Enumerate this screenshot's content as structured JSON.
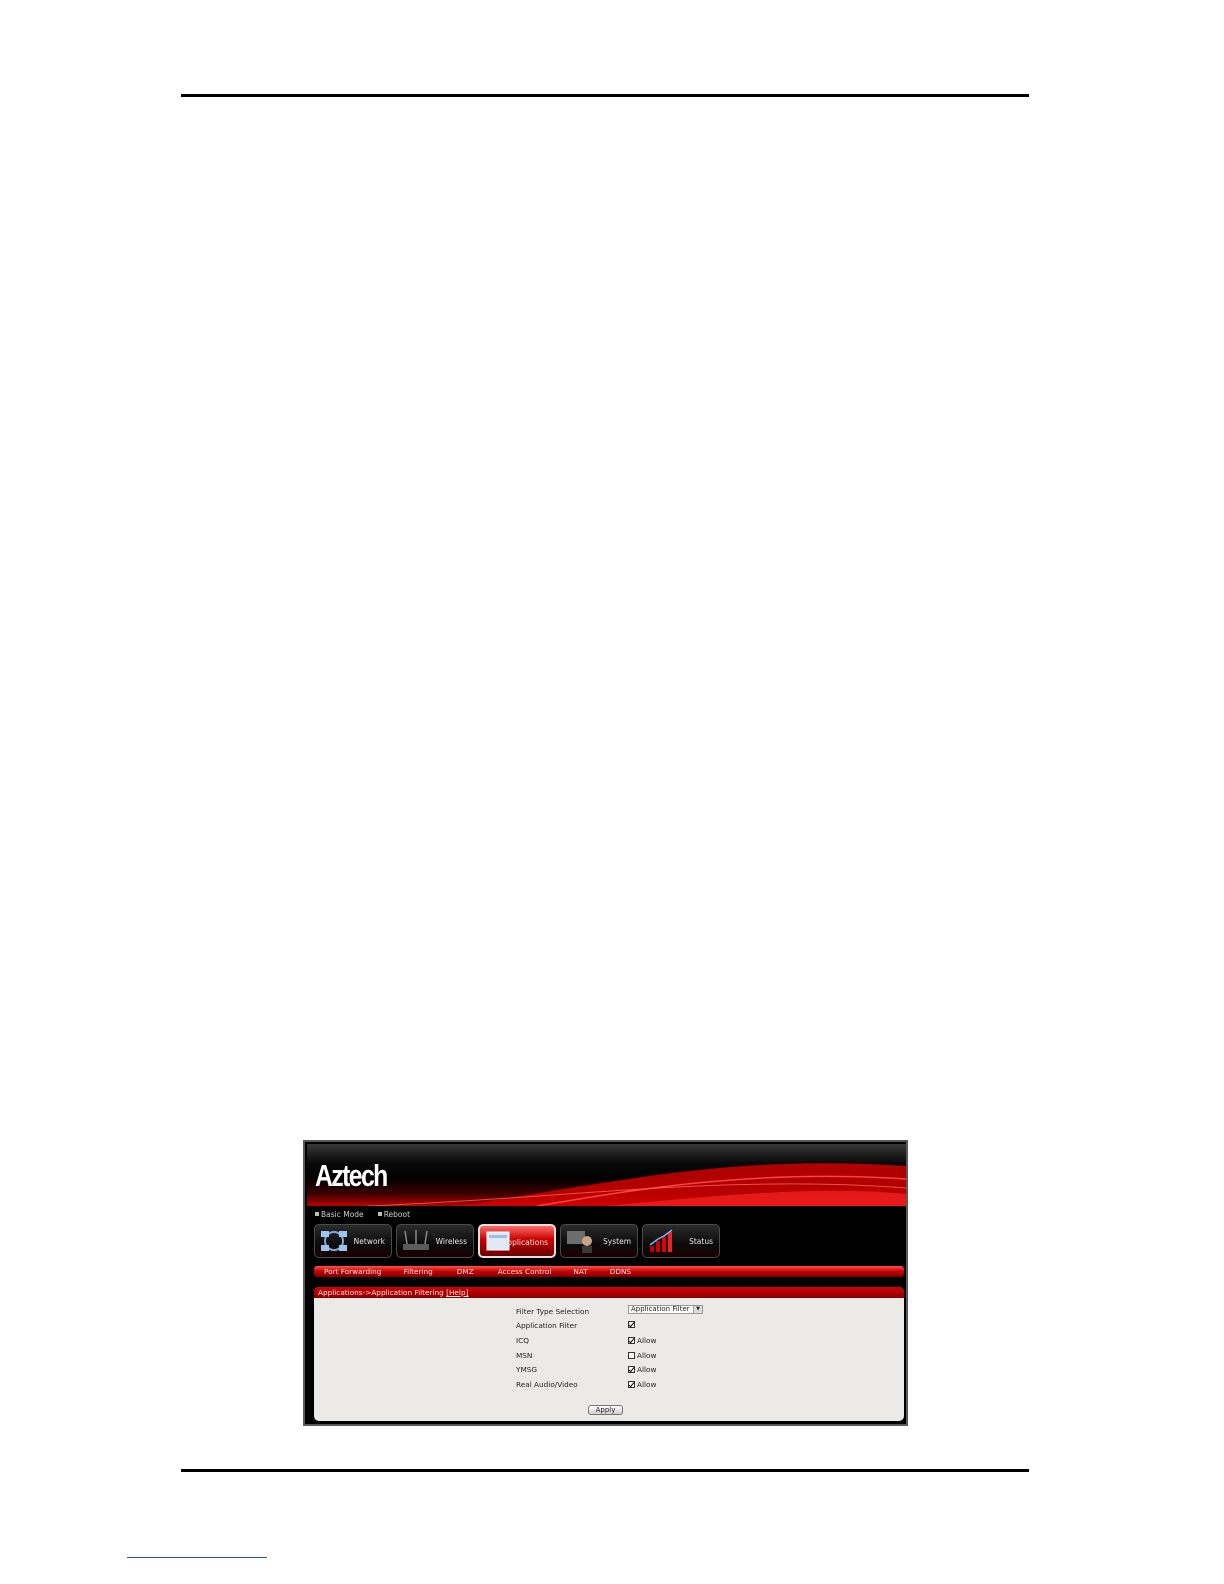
{
  "brand": {
    "logo_text": "Aztech",
    "accent": "#c80000"
  },
  "top_links": [
    {
      "label": "Basic Mode"
    },
    {
      "label": "Reboot"
    }
  ],
  "nav": [
    {
      "label": "Network",
      "icon": "network-icon",
      "active": false
    },
    {
      "label": "Wireless",
      "icon": "router-icon",
      "active": false
    },
    {
      "label": "Applications",
      "icon": "applications-icon",
      "active": true
    },
    {
      "label": "System",
      "icon": "system-icon",
      "active": false
    },
    {
      "label": "Status",
      "icon": "status-icon",
      "active": false
    }
  ],
  "subnav": [
    {
      "label": "Port Forwarding"
    },
    {
      "label": "Filtering"
    },
    {
      "label": "DMZ"
    },
    {
      "label": "Access Control"
    },
    {
      "label": "NAT"
    },
    {
      "label": "DDNS"
    }
  ],
  "panel": {
    "breadcrumb": "Applications->Application Filtering ",
    "help_label": "[Help]"
  },
  "form": {
    "filter_type_label": "Filter Type Selection",
    "filter_type_value": "Application Filter",
    "app_filter_label": "Application Filter",
    "app_filter_checked": true,
    "rows": [
      {
        "label": "ICQ",
        "allow": "Allow",
        "checked": true
      },
      {
        "label": "MSN",
        "allow": "Allow",
        "checked": false
      },
      {
        "label": "YMSG",
        "allow": "Allow",
        "checked": true
      },
      {
        "label": "Real Audio/Video",
        "allow": "Allow",
        "checked": true
      }
    ],
    "apply_label": "Apply"
  }
}
